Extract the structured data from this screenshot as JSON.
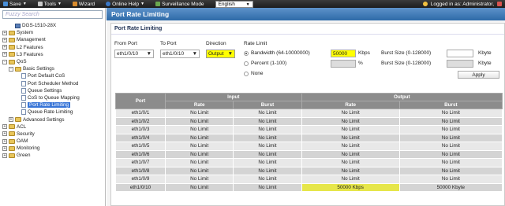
{
  "topbar": {
    "save": "Save",
    "tools": "Tools",
    "wizard": "Wizard",
    "online_help": "Online Help",
    "surveillance": "Surveillance Mode",
    "language": "English",
    "user": "Logged in as: Administrator,"
  },
  "sidebar": {
    "search_placeholder": "Fuzzy Search",
    "items": [
      {
        "label": "DGS-1510-28X",
        "level": 1,
        "icon": "device-icon",
        "toggle": ""
      },
      {
        "label": "System",
        "level": 0,
        "icon": "folder-icon",
        "toggle": "+"
      },
      {
        "label": "Management",
        "level": 0,
        "icon": "folder-icon",
        "toggle": "+"
      },
      {
        "label": "L2 Features",
        "level": 0,
        "icon": "folder-icon",
        "toggle": "+"
      },
      {
        "label": "L3 Features",
        "level": 0,
        "icon": "folder-icon",
        "toggle": "+"
      },
      {
        "label": "QoS",
        "level": 0,
        "icon": "folder-icon",
        "toggle": "-"
      },
      {
        "label": "Basic Settings",
        "level": 1,
        "icon": "folder-icon",
        "toggle": "-"
      },
      {
        "label": "Port Default CoS",
        "level": 3,
        "icon": "page-icon",
        "toggle": ""
      },
      {
        "label": "Port Scheduler Method",
        "level": 3,
        "icon": "page-icon",
        "toggle": ""
      },
      {
        "label": "Queue Settings",
        "level": 3,
        "icon": "page-icon",
        "toggle": ""
      },
      {
        "label": "CoS to Queue Mapping",
        "level": 3,
        "icon": "page-icon",
        "toggle": ""
      },
      {
        "label": "Port Rate Limiting",
        "level": 3,
        "icon": "page-icon",
        "toggle": "",
        "selected": true
      },
      {
        "label": "Queue Rate Limiting",
        "level": 3,
        "icon": "page-icon",
        "toggle": ""
      },
      {
        "label": "Advanced Settings",
        "level": 1,
        "icon": "folder-icon",
        "toggle": "+"
      },
      {
        "label": "ACL",
        "level": 0,
        "icon": "folder-icon",
        "toggle": "+"
      },
      {
        "label": "Security",
        "level": 0,
        "icon": "folder-icon",
        "toggle": "+"
      },
      {
        "label": "OAM",
        "level": 0,
        "icon": "folder-icon",
        "toggle": "+"
      },
      {
        "label": "Monitoring",
        "level": 0,
        "icon": "folder-icon",
        "toggle": "+"
      },
      {
        "label": "Green",
        "level": 0,
        "icon": "folder-icon",
        "toggle": "+"
      }
    ]
  },
  "main": {
    "title": "Port Rate Limiting",
    "section": "Port Rate Limiting",
    "form": {
      "from_port_label": "From Port",
      "from_port_value": "eth1/0/10",
      "to_port_label": "To Port",
      "to_port_value": "eth1/0/10",
      "direction_label": "Direction",
      "direction_value": "Output",
      "rate_limit_label": "Rate Limit",
      "bandwidth_label": "Bandwidth (64-10000000)",
      "bandwidth_value": "50000",
      "bandwidth_unit": "Kbps",
      "percent_label": "Percent (1-100)",
      "percent_unit": "%",
      "none_label": "None",
      "burst_label_1": "Burst Size (0-128000)",
      "burst_label_2": "Burst Size (0-128000)",
      "burst_unit_1": "Kbyte",
      "burst_unit_2": "Kbyte",
      "apply_label": "Apply"
    },
    "table": {
      "col_port": "Port",
      "col_input": "Input",
      "col_output": "Output",
      "col_rate": "Rate",
      "col_burst": "Burst",
      "rows": [
        [
          "eth1/0/1",
          "No Limit",
          "No Limit",
          "No Limit",
          "No Limit"
        ],
        [
          "eth1/0/2",
          "No Limit",
          "No Limit",
          "No Limit",
          "No Limit"
        ],
        [
          "eth1/0/3",
          "No Limit",
          "No Limit",
          "No Limit",
          "No Limit"
        ],
        [
          "eth1/0/4",
          "No Limit",
          "No Limit",
          "No Limit",
          "No Limit"
        ],
        [
          "eth1/0/5",
          "No Limit",
          "No Limit",
          "No Limit",
          "No Limit"
        ],
        [
          "eth1/0/6",
          "No Limit",
          "No Limit",
          "No Limit",
          "No Limit"
        ],
        [
          "eth1/0/7",
          "No Limit",
          "No Limit",
          "No Limit",
          "No Limit"
        ],
        [
          "eth1/0/8",
          "No Limit",
          "No Limit",
          "No Limit",
          "No Limit"
        ],
        [
          "eth1/0/9",
          "No Limit",
          "No Limit",
          "No Limit",
          "No Limit"
        ],
        [
          "eth1/0/10",
          "No Limit",
          "No Limit",
          "50000 Kbps",
          "50000 Kbyte"
        ]
      ]
    }
  },
  "colors": {
    "highlight": "#ffff00",
    "title_bar": "#2d6aa8",
    "header_gray": "#8c8c8c"
  }
}
